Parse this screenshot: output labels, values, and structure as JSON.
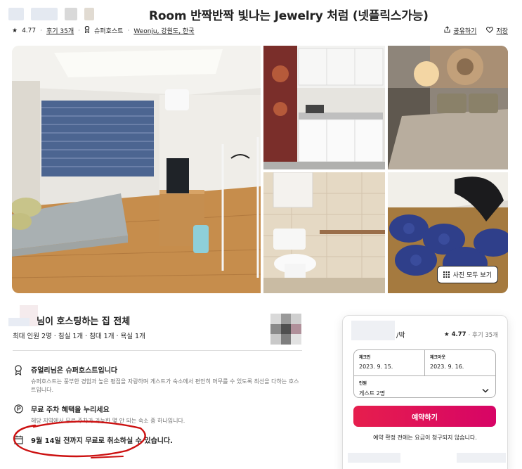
{
  "listing": {
    "title": "Room 반짝반짝 빛나는 Jewelry 처럼 (넷플릭스가능)",
    "rating": "4.77",
    "reviews_link": "후기 35개",
    "superhost": "슈퍼호스트",
    "location": "Weonju, 강원도, 한국",
    "share_label": "공유하기",
    "save_label": "저장"
  },
  "gallery": {
    "show_all_label": "사진 모두 보기"
  },
  "host": {
    "title": "님이 호스팅하는 집 전체",
    "details": "최대 인원 2명 · 침실 1개 · 침대 1개 · 욕실 1개"
  },
  "features": [
    {
      "icon": "superhost-medal-icon",
      "title": "쥬얼리님은 슈퍼호스트입니다",
      "desc": "슈퍼호스트는 풍부한 경험과 높은 평점을 자랑하며 게스트가 숙소에서 편안히 머무를 수 있도록 최선을 다하는 호스트입니다."
    },
    {
      "icon": "parking-icon",
      "title": "무료 주차 혜택을 누리세요",
      "desc": "해당 지역에서 무료 주차가 가능한 몇 안 되는 숙소 중 하나입니다."
    },
    {
      "icon": "calendar-icon",
      "title": "9월 14일 전까지 무료로 취소하실 수 있습니다.",
      "desc": ""
    }
  ],
  "booking": {
    "per_night": "/박",
    "rating": "4.77",
    "reviews": "· 후기 35개",
    "checkin_label": "체크인",
    "checkin_value": "2023. 9. 15.",
    "checkout_label": "체크아웃",
    "checkout_value": "2023. 9. 16.",
    "guests_label": "인원",
    "guests_value": "게스트 2명",
    "reserve_label": "예약하기",
    "note": "예약 확정 전에는 요금이 청구되지 않습니다."
  },
  "colors": {
    "accent": "#e61e4d",
    "scribble": "#cc1111"
  }
}
